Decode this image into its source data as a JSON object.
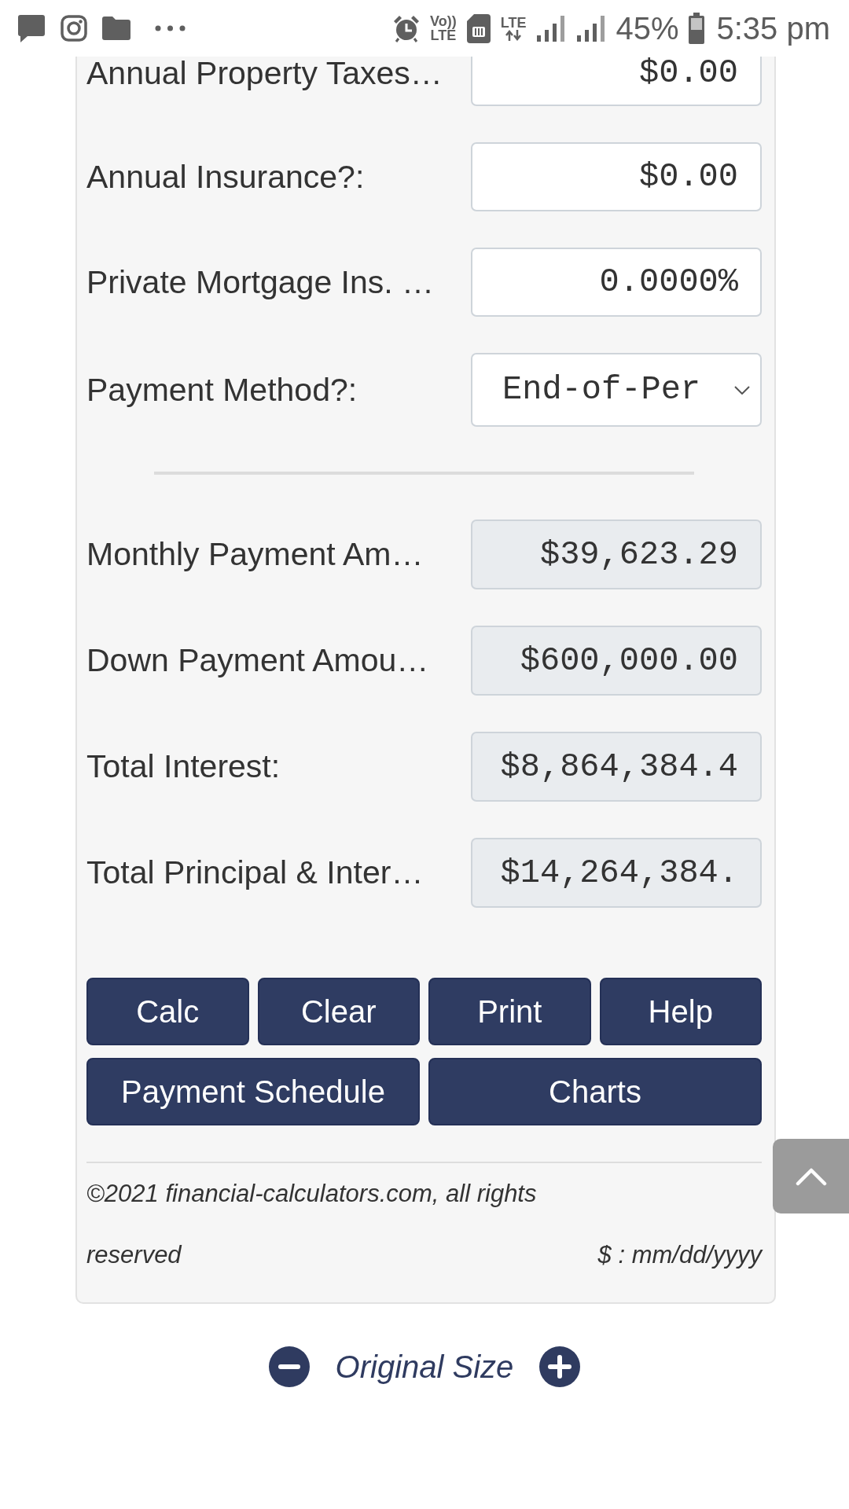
{
  "status_bar": {
    "volte_top": "Vo))",
    "volte_bottom": "LTE",
    "network_type": "LTE",
    "battery_percent": "45%",
    "time": "5:35 pm"
  },
  "form": {
    "inputs": [
      {
        "label": "Annual Property Taxes…",
        "value": "$0.00",
        "kind": "input"
      },
      {
        "label": "Annual Insurance?:",
        "value": "$0.00",
        "kind": "input"
      },
      {
        "label": "Private Mortgage Ins. …",
        "value": "0.0000%",
        "kind": "input"
      },
      {
        "label": "Payment Method?:",
        "value": "End-of-Per",
        "kind": "select"
      }
    ],
    "results": [
      {
        "label": "Monthly Payment Am…",
        "value": "$39,623.29"
      },
      {
        "label": "Down Payment Amou…",
        "value": "$600,000.00"
      },
      {
        "label": "Total Interest:",
        "value": "$8,864,384.4"
      },
      {
        "label": "Total Principal & Inter…",
        "value": "$14,264,384."
      }
    ]
  },
  "button_rows": [
    [
      {
        "label": "Calc"
      },
      {
        "label": "Clear"
      },
      {
        "label": "Print"
      },
      {
        "label": "Help"
      }
    ],
    [
      {
        "label": "Payment Schedule"
      },
      {
        "label": "Charts"
      }
    ]
  ],
  "footer": {
    "copyright": "©2021 financial-calculators.com, all rights reserved",
    "format_note": "$ : mm/dd/yyyy"
  },
  "zoom_controls": {
    "label": "Original Size"
  }
}
